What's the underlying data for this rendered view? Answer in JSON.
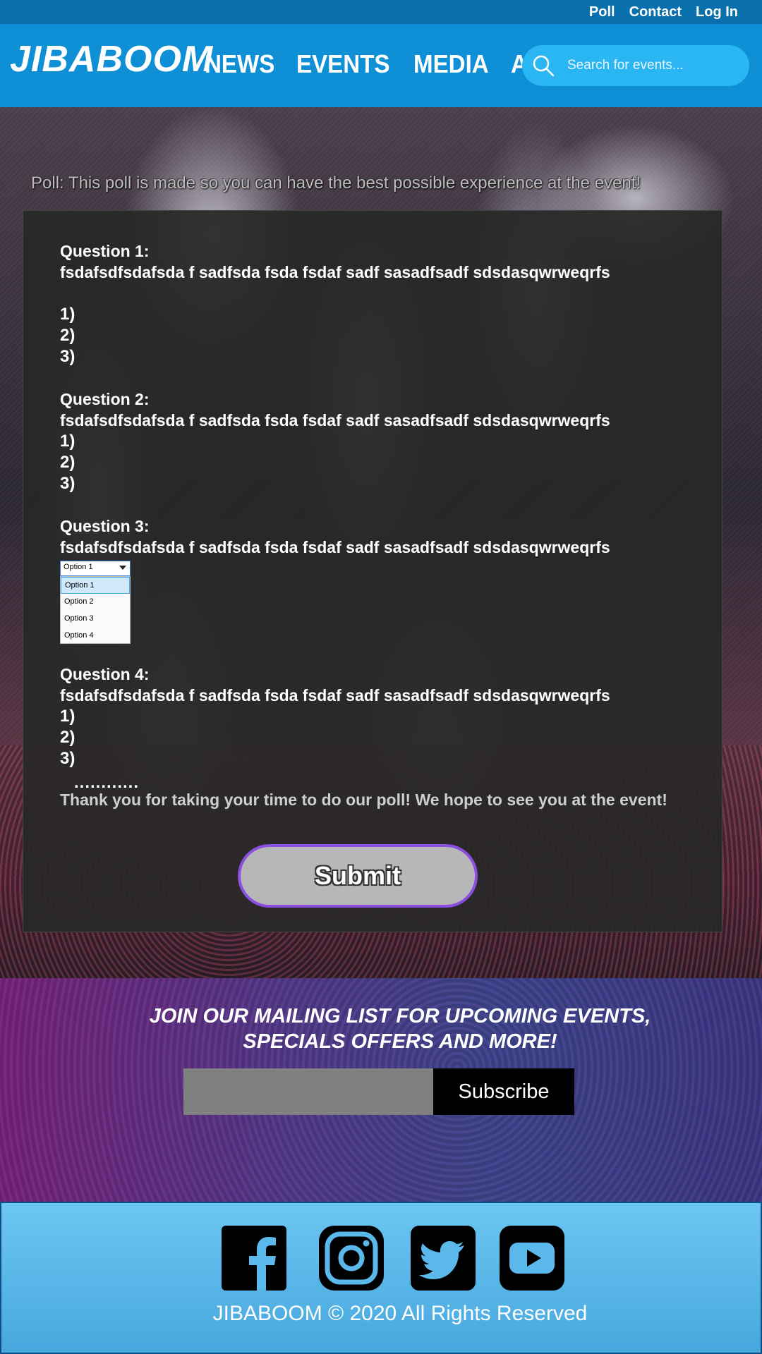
{
  "topbar": {
    "links": [
      "Poll",
      "Contact",
      "Log In"
    ]
  },
  "header": {
    "logo": "JIBABOOM",
    "nav": [
      "NEWS",
      "EVENTS",
      "MEDIA",
      "ABOUT"
    ],
    "search_placeholder": "Search for events..."
  },
  "poll": {
    "title": "Poll: This poll is made so you can have the best possible experience at the event!",
    "questions": [
      {
        "label": "Question 1:",
        "text": "fsdafsdfsdafsda f sadfsda fsda fsdaf sadf sasadfsadf sdsdasqwrweqrfs",
        "options": [
          "1)",
          "2)",
          "3)"
        ]
      },
      {
        "label": "Question 2:",
        "text": "fsdafsdfsdafsda f sadfsda fsda fsdaf sadf sasadfsadf sdsdasqwrweqrfs",
        "options": [
          "1)",
          "2)",
          "3)"
        ]
      },
      {
        "label": "Question 3:",
        "text": "fsdafsdfsdafsda f sadfsda fsda fsdaf sadf sasadfsadf sdsdasqwrweqrfs",
        "select": {
          "value": "Option 1",
          "options": [
            "Option 1",
            "Option 2",
            "Option 3",
            "Option 4"
          ]
        }
      },
      {
        "label": "Question 4:",
        "text": "fsdafsdfsdafsda f sadfsda fsda fsdaf sadf sasadfsadf sdsdasqwrweqrfs",
        "options": [
          "1)",
          "2)",
          "3)"
        ]
      }
    ],
    "ellipsis": "............",
    "thanks": "Thank you for taking your time to do our poll! We hope to see you at the event!",
    "submit_label": "Submit"
  },
  "mailing": {
    "title_line1": "JOIN OUR MAILING LIST FOR UPCOMING EVENTS,",
    "title_line2": "SPECIALS OFFERS AND MORE!",
    "subscribe_label": "Subscribe"
  },
  "footer": {
    "social_icons": [
      "facebook-icon",
      "instagram-icon",
      "twitter-icon",
      "youtube-icon"
    ],
    "copyright": "JIBABOOM © 2020 All Rights Reserved"
  },
  "colors": {
    "topbar": "#0a6fad",
    "header": "#0e8fd6",
    "search": "#29b6f2",
    "submit_border": "#8a4fe0",
    "footer": "#5ab8ea"
  }
}
